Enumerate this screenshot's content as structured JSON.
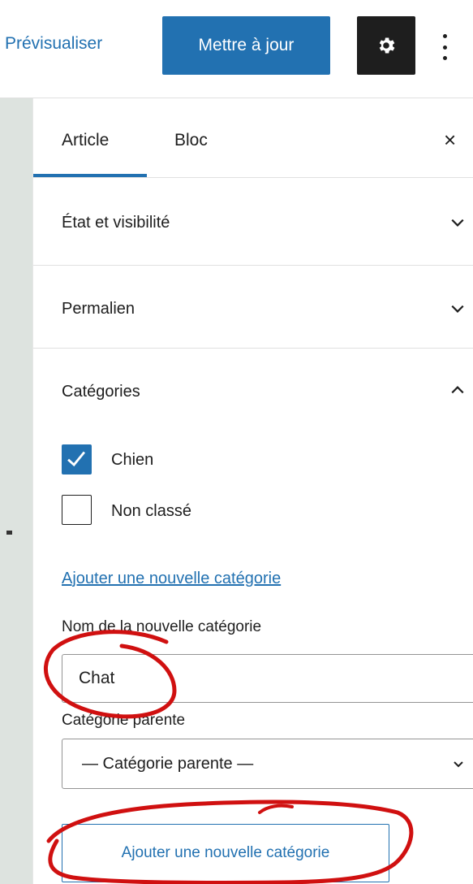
{
  "toolbar": {
    "preview_label": "Prévisualiser",
    "update_label": "Mettre à jour",
    "settings_icon": "gear-icon",
    "more_icon": "vertical-ellipsis-icon"
  },
  "sidebar": {
    "tabs": [
      {
        "label": "Article",
        "active": true
      },
      {
        "label": "Bloc",
        "active": false
      }
    ],
    "close_icon": "×",
    "panels": [
      {
        "title": "État et visibilité",
        "expanded": false
      },
      {
        "title": "Permalien",
        "expanded": false
      },
      {
        "title": "Catégories",
        "expanded": true
      }
    ]
  },
  "categories": {
    "items": [
      {
        "label": "Chien",
        "checked": true
      },
      {
        "label": "Non classé",
        "checked": false
      }
    ],
    "add_link": "Ajouter une nouvelle catégorie",
    "new_name_label": "Nom de la nouvelle catégorie",
    "new_name_value": "Chat",
    "parent_label": "Catégorie parente",
    "parent_selected": "— Catégorie parente —",
    "add_button": "Ajouter une nouvelle catégorie"
  },
  "colors": {
    "accent": "#2271b1",
    "dark": "#1e1e1e",
    "annotation": "#d01010",
    "left_strip": "#dde3df"
  }
}
